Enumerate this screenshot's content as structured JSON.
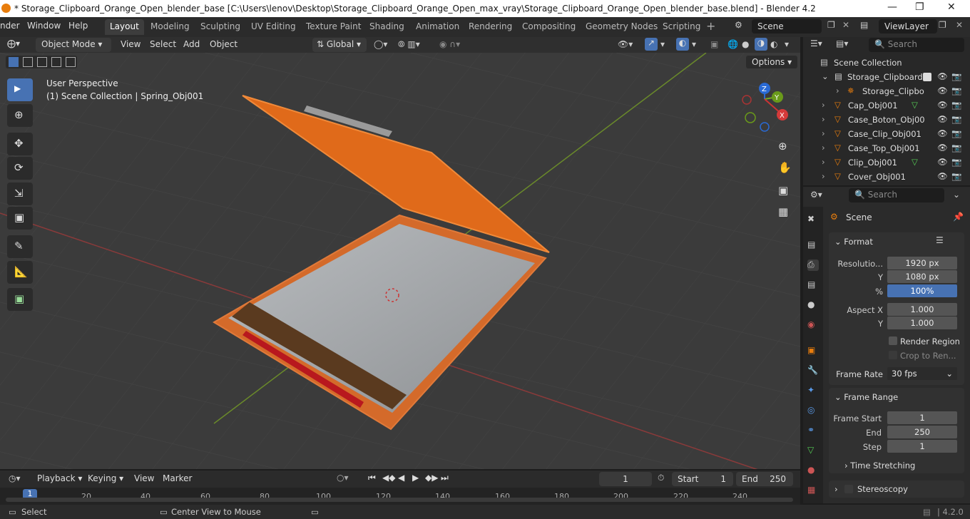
{
  "window": {
    "title": "* Storage_Clipboard_Orange_Open_blender_base [C:\\Users\\lenov\\Desktop\\Storage_Clipboard_Orange_Open_max_vray\\Storage_Clipboard_Orange_Open_blender_base.blend] - Blender 4.2"
  },
  "menu": {
    "items": [
      "nder",
      "Window",
      "Help"
    ],
    "workspaces": [
      "Layout",
      "Modeling",
      "Sculpting",
      "UV Editing",
      "Texture Paint",
      "Shading",
      "Animation",
      "Rendering",
      "Compositing",
      "Geometry Nodes",
      "Scripting"
    ],
    "active_workspace": "Layout",
    "scene": "Scene",
    "view_layer": "ViewLayer"
  },
  "header3d": {
    "mode": "Object Mode",
    "menus": [
      "View",
      "Select",
      "Add",
      "Object"
    ],
    "transform_orientation": "Global",
    "options_label": "Options"
  },
  "viewport": {
    "perspective": "User Perspective",
    "collection_info": "(1) Scene Collection | Spring_Obj001",
    "axes": {
      "x": "X",
      "y": "Y",
      "z": "Z"
    }
  },
  "outliner": {
    "search_placeholder": "Search",
    "root": "Scene Collection",
    "collection": "Storage_Clipboard",
    "child": "Storage_Clipbo",
    "objects": [
      "Cap_Obj001",
      "Case_Boton_Obj00",
      "Case_Clip_Obj001",
      "Case_Top_Obj001",
      "Clip_Obj001",
      "Cover_Obj001"
    ]
  },
  "properties": {
    "search_placeholder": "Search",
    "context": "Scene",
    "format": {
      "title": "Format",
      "resolution_label": "Resolutio...",
      "res_x": "1920 px",
      "y_label": "Y",
      "res_y": "1080 px",
      "pct_label": "%",
      "pct": "100%",
      "aspect_x_label": "Aspect X",
      "aspect_x": "1.000",
      "aspect_y_label": "Y",
      "aspect_y": "1.000",
      "render_region": "Render Region",
      "crop": "Crop to Ren...",
      "frame_rate_label": "Frame Rate",
      "frame_rate": "30 fps"
    },
    "frame_range": {
      "title": "Frame Range",
      "start_label": "Frame Start",
      "start": "1",
      "end_label": "End",
      "end": "250",
      "step_label": "Step",
      "step": "1"
    },
    "time_stretching": "Time Stretching",
    "stereoscopy": "Stereoscopy"
  },
  "timeline": {
    "menus": [
      "Playback",
      "Keying",
      "View",
      "Marker"
    ],
    "current_frame": "1",
    "start_label": "Start",
    "start": "1",
    "end_label": "End",
    "end": "250",
    "ticks": [
      "1",
      "20",
      "40",
      "60",
      "80",
      "100",
      "120",
      "140",
      "160",
      "180",
      "200",
      "220",
      "240"
    ]
  },
  "status": {
    "select": "Select",
    "center": "Center View to Mouse",
    "version": "4.2.0"
  },
  "colors": {
    "accent": "#4772b3",
    "orange": "#e87d0d"
  }
}
